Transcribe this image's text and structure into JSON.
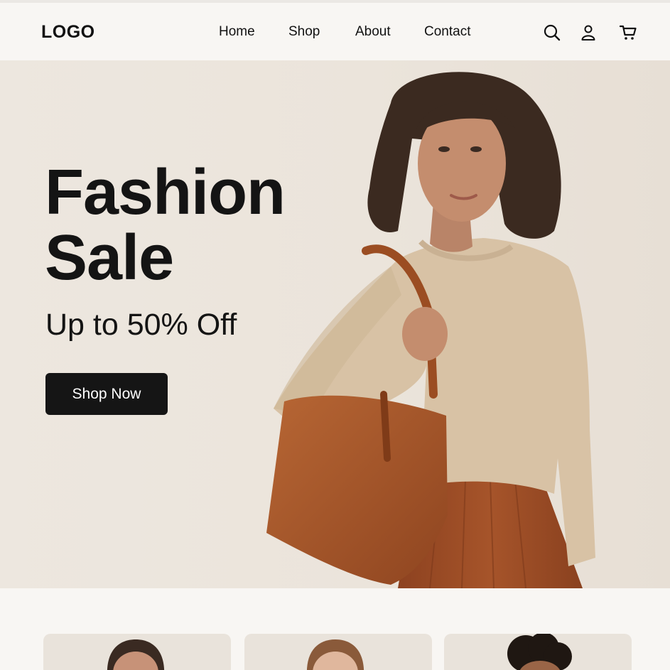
{
  "header": {
    "logo": "LOGO",
    "nav": [
      "Home",
      "Shop",
      "About",
      "Contact"
    ],
    "icons": [
      "search-icon",
      "account-icon",
      "cart-icon"
    ]
  },
  "hero": {
    "title_line1": "Fashion",
    "title_line2": "Sale",
    "subtitle": "Up to 50% Off",
    "cta_label": "Shop Now"
  },
  "colors": {
    "background": "#f8f6f3",
    "hero_bg": "#ebe4db",
    "button": "#151515",
    "sweater": "#d9c3a6",
    "bag": "#a9592b",
    "skirt": "#9a4a24"
  }
}
